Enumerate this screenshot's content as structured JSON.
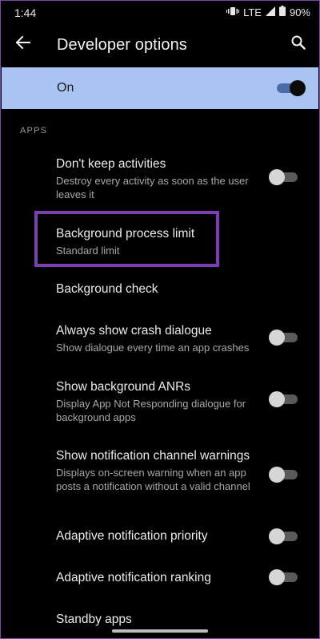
{
  "status_bar": {
    "time": "1:44",
    "network": "LTE",
    "battery": "90%"
  },
  "app_bar": {
    "title": "Developer options",
    "back_icon": "arrow-back-icon",
    "search_icon": "search-icon"
  },
  "master_switch": {
    "label": "On",
    "state": "on"
  },
  "section": {
    "label": "APPS"
  },
  "items": [
    {
      "title": "Don't keep activities",
      "subtitle": "Destroy every activity as soon as the user leaves it",
      "toggle": "off"
    },
    {
      "title": "Background process limit",
      "subtitle": "Standard limit"
    },
    {
      "title": "Background check"
    },
    {
      "title": "Always show crash dialogue",
      "subtitle": "Show dialogue every time an app crashes",
      "toggle": "off"
    },
    {
      "title": "Show background ANRs",
      "subtitle": "Display App Not Responding dialogue for background apps",
      "toggle": "off"
    },
    {
      "title": "Show notification channel warnings",
      "subtitle": "Displays on-screen warning when an app posts a notification without a valid channel",
      "toggle": "off"
    },
    {
      "title": "Adaptive notification priority",
      "toggle": "off"
    },
    {
      "title": "Adaptive notification ranking",
      "toggle": "off"
    },
    {
      "title": "Standby apps"
    }
  ],
  "colors": {
    "background": "#000000",
    "master_bar": "#a9c3f2",
    "highlight": "#7b3fb0"
  }
}
